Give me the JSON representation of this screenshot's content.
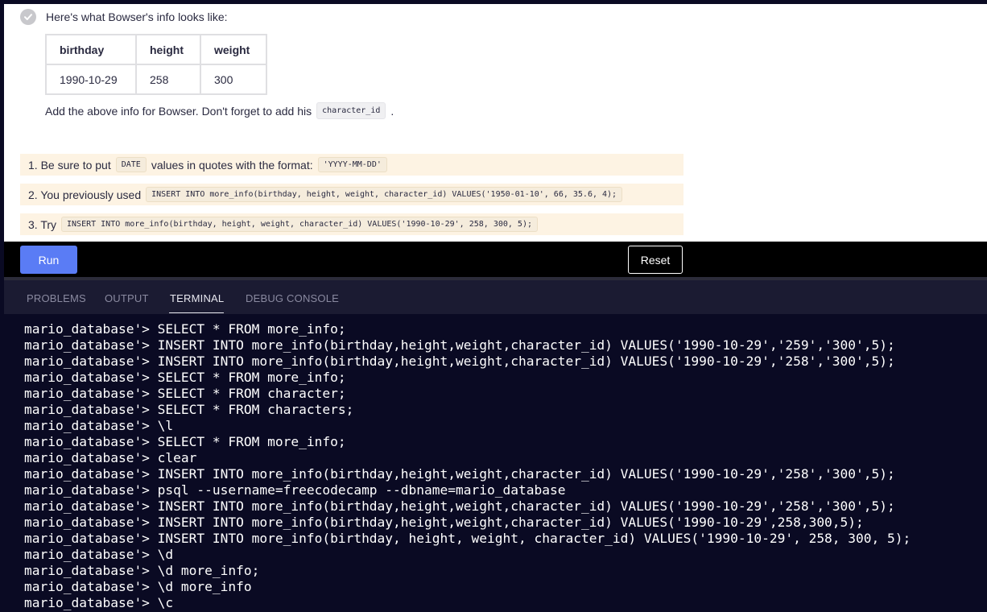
{
  "lesson": {
    "intro_text": "Here's what Bowser's info looks like:",
    "table": {
      "headers": [
        "birthday",
        "height",
        "weight"
      ],
      "row": [
        "1990-10-29",
        "258",
        "300"
      ]
    },
    "instruction_pre": "Add the above info for Bowser. Don't forget to add his",
    "instruction_code": "character_id",
    "instruction_post": ".",
    "hints": [
      {
        "pre": "1. Be sure to put",
        "code": "DATE",
        "mid": "values in quotes with the format:",
        "code2": "'YYYY-MM-DD'"
      },
      {
        "pre": "2. You previously used",
        "code": "INSERT INTO more_info(birthday, height, weight, character_id) VALUES('1950-01-10', 66, 35.6, 4);"
      },
      {
        "pre": "3. Try",
        "code": "INSERT INTO more_info(birthday, height, weight, character_id) VALUES('1990-10-29', 258, 300, 5);"
      }
    ]
  },
  "buttons": {
    "run_label": "Run",
    "reset_label": "Reset"
  },
  "panel": {
    "tabs": [
      "PROBLEMS",
      "OUTPUT",
      "TERMINAL",
      "DEBUG CONSOLE"
    ],
    "active_tab": "TERMINAL"
  },
  "terminal": {
    "lines": [
      "mario_database'> SELECT * FROM more_info;",
      "mario_database'> INSERT INTO more_info(birthday,height,weight,character_id) VALUES('1990-10-29','259','300',5);",
      "mario_database'> INSERT INTO more_info(birthday,height,weight,character_id) VALUES('1990-10-29','258','300',5);",
      "mario_database'> SELECT * FROM more_info;",
      "mario_database'> SELECT * FROM character;",
      "mario_database'> SELECT * FROM characters;",
      "mario_database'> \\l",
      "mario_database'> SELECT * FROM more_info;",
      "mario_database'> clear",
      "mario_database'> INSERT INTO more_info(birthday,height,weight,character_id) VALUES('1990-10-29','258','300',5);",
      "mario_database'> psql --username=freecodecamp --dbname=mario_database",
      "mario_database'> INSERT INTO more_info(birthday,height,weight,character_id) VALUES('1990-10-29','258','300',5);",
      "mario_database'> INSERT INTO more_info(birthday,height,weight,character_id) VALUES('1990-10-29',258,300,5);",
      "mario_database'> INSERT INTO more_info(birthday, height, weight, character_id) VALUES('1990-10-29', 258, 300, 5);",
      "mario_database'> \\d",
      "mario_database'> \\d more_info;",
      "mario_database'> \\d more_info",
      "mario_database'> \\c"
    ]
  },
  "colors": {
    "accent_run": "#5a7cf5",
    "hint_bg": "#fdf3e3",
    "terminal_bg": "#0a0a23",
    "tabs_bg": "#1b1b32"
  }
}
